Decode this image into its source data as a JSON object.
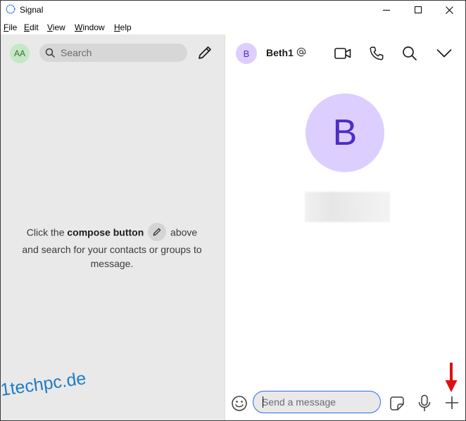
{
  "window": {
    "title": "Signal"
  },
  "menu": {
    "items": [
      "File",
      "Edit",
      "View",
      "Window",
      "Help"
    ]
  },
  "sidebar": {
    "avatar_initials": "AA",
    "search_placeholder": "Search",
    "empty_message": {
      "line_start": "Click the ",
      "bold": "compose button",
      "line_after_icon": " above",
      "rest": "and search for your contacts or groups to message."
    }
  },
  "conversation": {
    "avatar_initial": "B",
    "name": "Beth1",
    "big_avatar_initial": "B",
    "composer_placeholder": "Send a message"
  },
  "watermark": "1techpc.de",
  "colors": {
    "accent": "#2c6bed",
    "avatar_purple_bg": "#dccfff",
    "avatar_purple_fg": "#4a2ec4",
    "avatar_green_bg": "#c4e8c4",
    "sidebar_bg": "#e9e9e9",
    "arrow_red": "#e01010",
    "watermark_blue": "#1f7bc4"
  },
  "icons": {
    "app": "signal-logo-icon",
    "minimize": "minimize-icon",
    "maximize": "maximize-icon",
    "close": "close-icon",
    "search": "search-icon",
    "compose": "pencil-icon",
    "mention": "at-sign-icon",
    "video": "video-camera-icon",
    "call": "phone-icon",
    "conv_search": "search-icon",
    "more": "chevron-down-icon",
    "emoji": "emoji-icon",
    "sticker": "sticker-icon",
    "mic": "microphone-icon",
    "attach": "plus-icon",
    "annotation": "red-arrow-icon"
  }
}
